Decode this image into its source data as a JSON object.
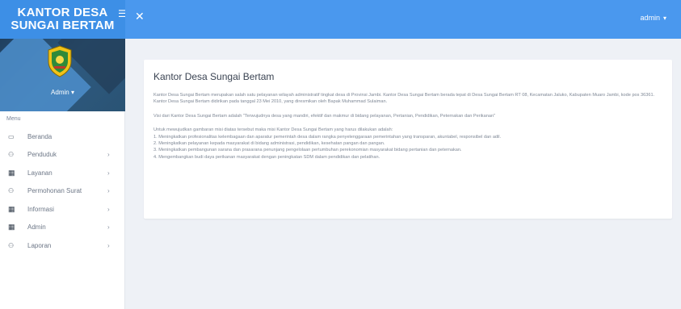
{
  "header": {
    "brand_line1": "KANTOR DESA",
    "brand_line2": "SUNGAI BERTAM",
    "menu_toggle_icon": "hamburger-icon",
    "close_icon": "close-icon",
    "user_label": "admin",
    "user_caret_icon": "chevron-down-icon",
    "colors": {
      "brand_bg": "#3d8fe6",
      "topbar_bg": "#4a98ee"
    }
  },
  "sidebar": {
    "profile_name": "Admin",
    "profile_caret": "▾",
    "section_label": "Menu",
    "items": [
      {
        "label": "Beranda",
        "icon": "monitor-icon",
        "has_submenu": false
      },
      {
        "label": "Penduduk",
        "icon": "users-icon",
        "has_submenu": true
      },
      {
        "label": "Layanan",
        "icon": "grid-icon",
        "has_submenu": true
      },
      {
        "label": "Permohonan Surat",
        "icon": "users-icon",
        "has_submenu": true
      },
      {
        "label": "Informasi",
        "icon": "grid-icon",
        "has_submenu": true
      },
      {
        "label": "Admin",
        "icon": "grid-icon",
        "has_submenu": true
      },
      {
        "label": "Laporan",
        "icon": "users-icon",
        "has_submenu": true
      }
    ]
  },
  "main": {
    "title": "Kantor Desa Sungai Bertam",
    "paragraphs": [
      "Kantor Desa Sungai Bertam merupakan salah satu pelayanan wilayah administratif tingkat desa di Provinsi Jambi. Kantor Desa Sungai Bertam berada tepat di Desa Sungai Bertam RT 08, Kecamatan Jaluko, Kabupaten Muaro Jambi, kode pos 36361. Kantor Desa Sungai Bertam didirikan pada tanggal 23 Mei 2010, yang diresmikan oleh Bapak Muhammad Sulaiman.",
      "Visi dari Kantor Desa Sungai Bertam adalah \"Terwujudnya desa yang mandiri, efektif dan makmur di bidang pelayanan, Pertanian, Pendidikan, Peternakan dan Perikanan\"",
      "Untuk mewujudkan gambaran misi diatas tersebut maka misi Kantor Desa Sungai Bertam yang harus dilakukan adalah:"
    ],
    "missions": [
      "1. Meningkatkan profesionalitas kelembagaan dan aparatur pemerintah desa dalam rangka penyelenggaraan pemerintahan yang transparan, akuntabel, responsibel dan adil.",
      "2. Meningkatkan pelayanan kepada masyarakat di bidang administrasi, pendidikan, kesehatan pangan dan pangan.",
      "3. Meningkatkan pembangunan sarana dan prasarana penunjang pengelolaan pertumbuhan perekonomian masyarakat bidang pertanian dan peternakan.",
      "4. Mengembangkan budi daya perikanan masyarakat dengan peningkatan SDM dalam pendidikan dan pelatihan."
    ]
  }
}
